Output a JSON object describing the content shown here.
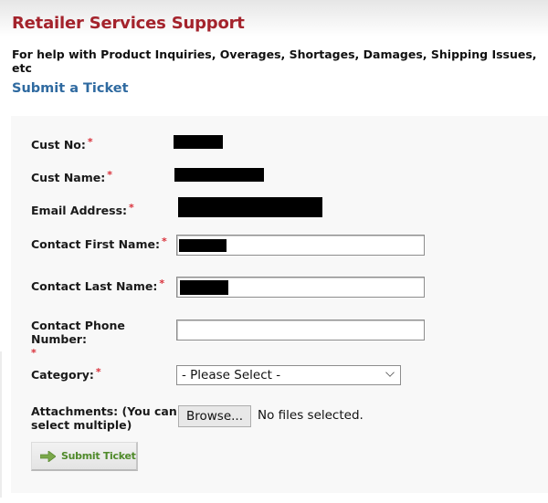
{
  "header": {
    "title": "Retailer Services Support",
    "subtitle": "For help with Product Inquiries, Overages, Shortages, Damages, Shipping Issues, etc",
    "section_title": "Submit a Ticket"
  },
  "form": {
    "required_marker": "*",
    "fields": {
      "cust_no": {
        "label": "Cust No:",
        "value_redacted": true
      },
      "cust_name": {
        "label": "Cust Name:",
        "value_redacted": true
      },
      "email": {
        "label": "Email Address:",
        "value_redacted": true
      },
      "first_name": {
        "label": "Contact First Name:",
        "value_redacted": true
      },
      "last_name": {
        "label": "Contact Last Name:",
        "value_redacted": true
      },
      "phone": {
        "label": "Contact Phone Number:",
        "value": ""
      },
      "category": {
        "label": "Category:",
        "selected": "- Please Select -"
      },
      "attachments": {
        "label_line1": "Attachments: (You can",
        "label_line2": "select multiple)",
        "browse_label": "Browse...",
        "status": "No files selected."
      }
    },
    "submit": {
      "label": "Submit Ticket",
      "icon": "arrow-right-icon"
    }
  },
  "colors": {
    "title": "#a4232c",
    "section_link": "#2f6aa0",
    "required": "#d9303a",
    "submit_text": "#4f8a2a"
  }
}
